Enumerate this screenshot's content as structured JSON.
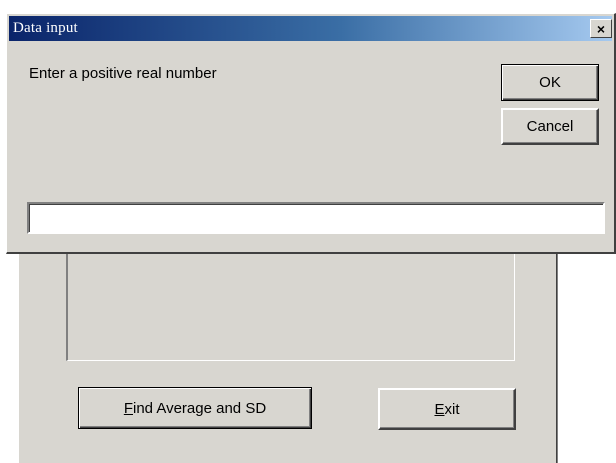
{
  "dialog": {
    "title": "Data input",
    "close_glyph": "×",
    "prompt": "Enter a positive real number",
    "ok_label": "OK",
    "cancel_label": "Cancel",
    "input_value": ""
  },
  "main_form": {
    "find_button": {
      "accel": "F",
      "rest": "ind Average and SD"
    },
    "exit_button": {
      "accel": "E",
      "rest": "xit"
    }
  },
  "colors": {
    "face": "#d8d6d0",
    "title_start": "#0a246a",
    "title_end": "#a6caf0"
  },
  "icons": {
    "close": "close-icon"
  }
}
